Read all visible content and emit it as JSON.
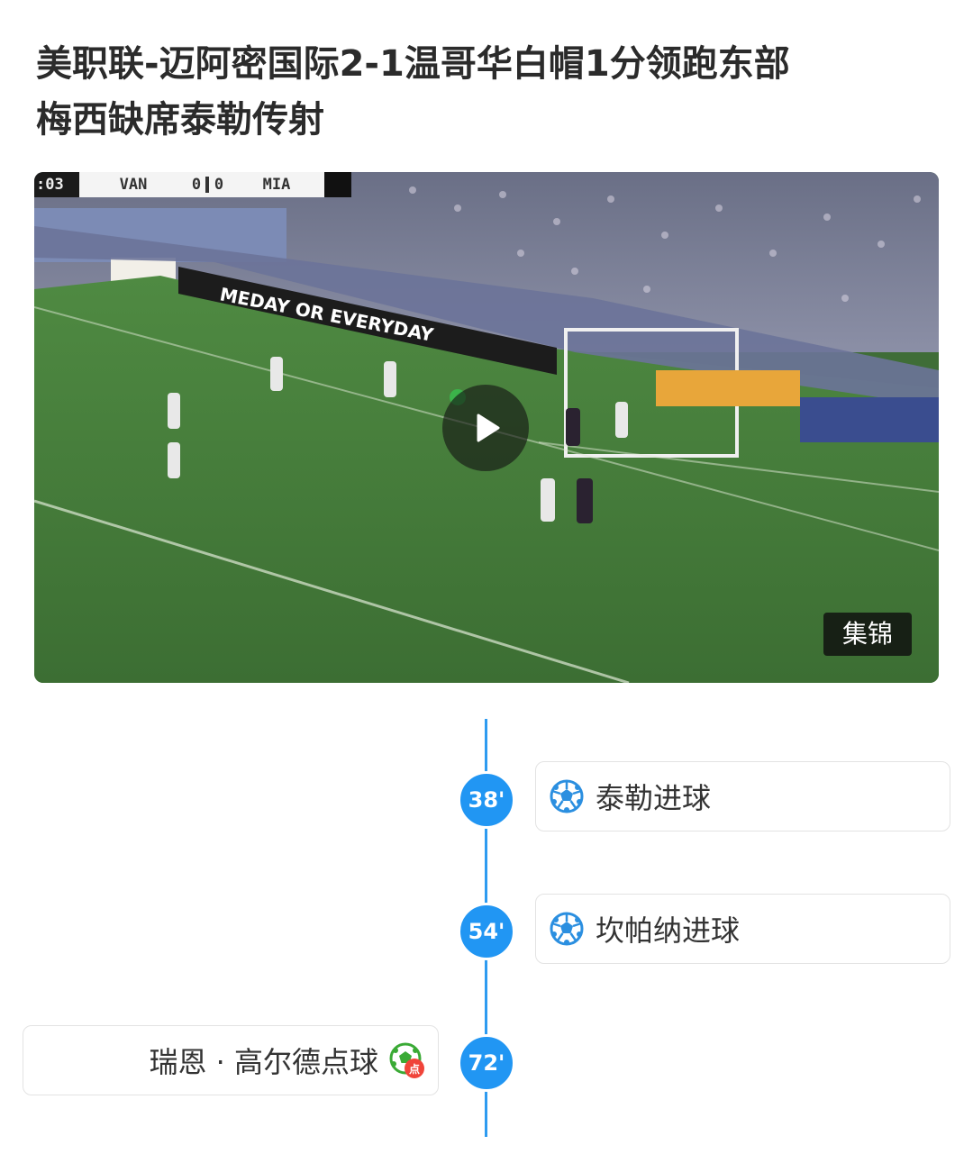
{
  "article": {
    "title_line1": "美职联-迈阿密国际2-1温哥华白帽1分领跑东部",
    "title_line2": "梅西缺席泰勒传射"
  },
  "video": {
    "scorebug": {
      "time": ":03",
      "home": "VAN",
      "home_score": "0",
      "away_score": "0",
      "away": "MIA"
    },
    "ad_board_text": "MEDAY OR EVERYDAY",
    "badge": "集锦"
  },
  "timeline": {
    "accent_color": "#2196f3",
    "events": [
      {
        "minute": "38'",
        "text": "泰勒进球",
        "side": "right",
        "icon": "soccer-ball-icon"
      },
      {
        "minute": "54'",
        "text": "坎帕纳进球",
        "side": "right",
        "icon": "soccer-ball-icon"
      },
      {
        "minute": "72'",
        "text": "瑞恩 · 高尔德点球",
        "side": "left",
        "icon": "penalty-ball-icon",
        "icon_label": "点"
      }
    ]
  }
}
